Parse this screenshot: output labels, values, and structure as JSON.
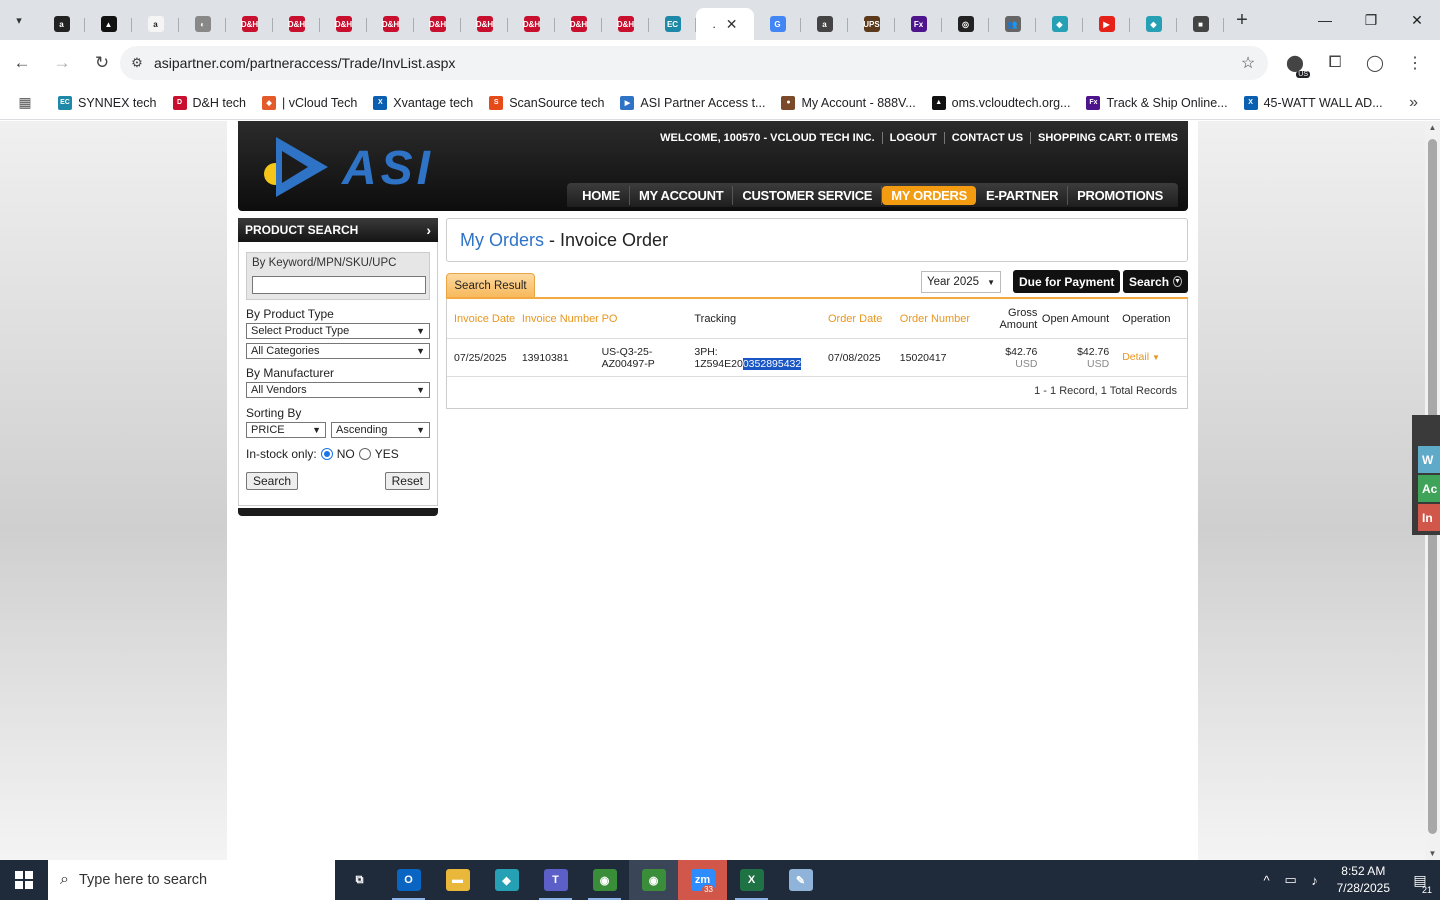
{
  "browser": {
    "tabs": [
      {
        "icon": "amazon-icon",
        "color": "#222",
        "glyph": "a"
      },
      {
        "icon": "triangle-logo-icon",
        "color": "#111",
        "glyph": "▲"
      },
      {
        "icon": "amazon-icon",
        "color": "#f5f5f5",
        "glyph": "a"
      },
      {
        "icon": "globe-icon",
        "color": "#888",
        "glyph": "◐"
      },
      {
        "icon": "dh-icon",
        "color": "#c8102e",
        "glyph": "D&H"
      },
      {
        "icon": "dh-icon",
        "color": "#c8102e",
        "glyph": "D&H"
      },
      {
        "icon": "dh-icon",
        "color": "#c8102e",
        "glyph": "D&H"
      },
      {
        "icon": "dh-icon",
        "color": "#c8102e",
        "glyph": "D&H"
      },
      {
        "icon": "dh-icon",
        "color": "#c8102e",
        "glyph": "D&H"
      },
      {
        "icon": "dh-icon",
        "color": "#c8102e",
        "glyph": "D&H"
      },
      {
        "icon": "dh-icon",
        "color": "#c8102e",
        "glyph": "D&H"
      },
      {
        "icon": "dh-icon",
        "color": "#c8102e",
        "glyph": "D&H"
      },
      {
        "icon": "dh-icon",
        "color": "#c8102e",
        "glyph": "D&H"
      },
      {
        "icon": "ec-icon",
        "color": "#1e88a8",
        "glyph": "EC"
      }
    ],
    "active_tab_close": "✕",
    "tabs_after": [
      {
        "icon": "google-icon",
        "color": "#4285f4",
        "glyph": "G"
      },
      {
        "icon": "amazon-icon",
        "color": "#444",
        "glyph": "a"
      },
      {
        "icon": "ups-icon",
        "color": "#5a3a1a",
        "glyph": "UPS"
      },
      {
        "icon": "fedex-icon",
        "color": "#4d148c",
        "glyph": "Fx"
      },
      {
        "icon": "target-icon",
        "color": "#222",
        "glyph": "◎"
      },
      {
        "icon": "people-icon",
        "color": "#666",
        "glyph": "👥"
      },
      {
        "icon": "diamond-icon",
        "color": "#26a0b5",
        "glyph": "◆"
      },
      {
        "icon": "youtube-icon",
        "color": "#e62117",
        "glyph": "▶"
      },
      {
        "icon": "diamond-icon",
        "color": "#26a0b5",
        "glyph": "◆"
      },
      {
        "icon": "media-icon",
        "color": "#444",
        "glyph": "■"
      }
    ],
    "new_tab": "+",
    "url": "asipartner.com/partneraccess/Trade/InvList.aspx",
    "vpn_badge": "US"
  },
  "bookmarks": [
    {
      "label": "SYNNEX tech",
      "icon": "ec-icon",
      "color": "#1e88a8",
      "glyph": "EC"
    },
    {
      "label": "D&H tech",
      "icon": "dh-icon",
      "color": "#c8102e",
      "glyph": "D"
    },
    {
      "label": "| vCloud Tech",
      "icon": "vcloud-icon",
      "color": "#e45b2b",
      "glyph": "◆"
    },
    {
      "label": "Xvantage tech",
      "icon": "xvantage-icon",
      "color": "#0b5fb0",
      "glyph": "X"
    },
    {
      "label": "ScanSource tech",
      "icon": "scansource-icon",
      "color": "#e64a19",
      "glyph": "S"
    },
    {
      "label": "ASI Partner Access t...",
      "icon": "asi-icon",
      "color": "#2f73c6",
      "glyph": "▶"
    },
    {
      "label": "My Account - 888V...",
      "icon": "people-icon",
      "color": "#7b4a2b",
      "glyph": "●"
    },
    {
      "label": "oms.vcloudtech.org...",
      "icon": "triangle-logo-icon",
      "color": "#111",
      "glyph": "▲"
    },
    {
      "label": "Track & Ship Online...",
      "icon": "fedex-icon",
      "color": "#4d148c",
      "glyph": "Fx"
    },
    {
      "label": "45-WATT WALL AD...",
      "icon": "xvantage-icon",
      "color": "#0b5fb0",
      "glyph": "X"
    }
  ],
  "site": {
    "logo_text": "ASI",
    "top_links": [
      "WELCOME, 100570 - VCLOUD TECH INC.",
      "LOGOUT",
      "CONTACT US",
      "SHOPPING CART: 0 ITEMS"
    ],
    "nav": [
      "HOME",
      "MY ACCOUNT",
      "CUSTOMER SERVICE",
      "MY ORDERS",
      "E-PARTNER",
      "PROMOTIONS"
    ],
    "nav_active": "MY ORDERS",
    "accent": "#f39c12",
    "brand_blue": "#2f73c6"
  },
  "sidebar": {
    "title": "PRODUCT SEARCH",
    "keyword_label": "By Keyword/MPN/SKU/UPC",
    "keyword_value": "",
    "product_type_label": "By Product Type",
    "product_type_value": "Select Product Type",
    "category_value": "All Categories",
    "manufacturer_label": "By Manufacturer",
    "manufacturer_value": "All Vendors",
    "sorting_label": "Sorting By",
    "sort_field": "PRICE",
    "sort_order": "Ascending",
    "instock_label": "In-stock only:",
    "instock_no": "NO",
    "instock_yes": "YES",
    "instock_selected": "NO",
    "search_button": "Search",
    "reset_button": "Reset"
  },
  "main": {
    "breadcrumb": "My Orders",
    "separator": " - ",
    "page_title": "Invoice Order",
    "result_tab": "Search Result",
    "year_select": "Year 2025",
    "due_button": "Due for Payment",
    "search_button": "Search",
    "columns": [
      {
        "key": "c1",
        "label": "Invoice Date",
        "style": "orange"
      },
      {
        "key": "c2",
        "label": "Invoice Number",
        "style": "orange"
      },
      {
        "key": "c3",
        "label": "PO",
        "style": "orange"
      },
      {
        "key": "c4",
        "label": "Tracking",
        "style": "black"
      },
      {
        "key": "c5",
        "label": "Order Date",
        "style": "orange"
      },
      {
        "key": "c6",
        "label": "Order Number",
        "style": "orange"
      },
      {
        "key": "c7",
        "label": "Gross Amount",
        "style": "black"
      },
      {
        "key": "c8",
        "label": "Open Amount",
        "style": "black"
      },
      {
        "key": "c9",
        "label": "Operation",
        "style": "black"
      }
    ],
    "rows": [
      {
        "invoice_date": "07/25/2025",
        "invoice_number": "13910381",
        "po": "US-Q3-25-AZ00497-P",
        "tracking_prefix": "3PH:",
        "tracking_plain": "1Z594E20",
        "tracking_selected": "0352895432",
        "order_date": "07/08/2025",
        "order_number": "15020417",
        "gross_amount": "$42.76",
        "gross_currency": "USD",
        "open_amount": "$42.76",
        "open_currency": "USD",
        "operation": "Detail"
      }
    ],
    "records_text": "1 - 1 Record,  1 Total Records"
  },
  "side_widget": [
    "W",
    "Ac",
    "In"
  ],
  "taskbar": {
    "search_placeholder": "Type here to search",
    "apps": [
      {
        "name": "task-view",
        "color": "transparent",
        "glyph": "⧉",
        "state": ""
      },
      {
        "name": "outlook",
        "color": "#0a64c2",
        "glyph": "O",
        "state": "open"
      },
      {
        "name": "file-explorer",
        "color": "#e9b83b",
        "glyph": "▬",
        "state": ""
      },
      {
        "name": "kodi",
        "color": "#26a0b5",
        "glyph": "◆",
        "state": ""
      },
      {
        "name": "teams",
        "color": "#5b5fc7",
        "glyph": "T",
        "state": "open"
      },
      {
        "name": "chrome",
        "color": "#3a8e3a",
        "glyph": "◉",
        "state": "open"
      },
      {
        "name": "chrome-active",
        "color": "#3a8e3a",
        "glyph": "◉",
        "state": "active"
      },
      {
        "name": "zoom",
        "color": "#2d8cff",
        "glyph": "zm",
        "state": "zoomapp",
        "badge": "33"
      },
      {
        "name": "excel",
        "color": "#1f7244",
        "glyph": "X",
        "state": "open"
      },
      {
        "name": "notepad",
        "color": "#8fb3d9",
        "glyph": "✎",
        "state": ""
      }
    ],
    "time": "8:52 AM",
    "date": "7/28/2025",
    "notifications": "21"
  }
}
